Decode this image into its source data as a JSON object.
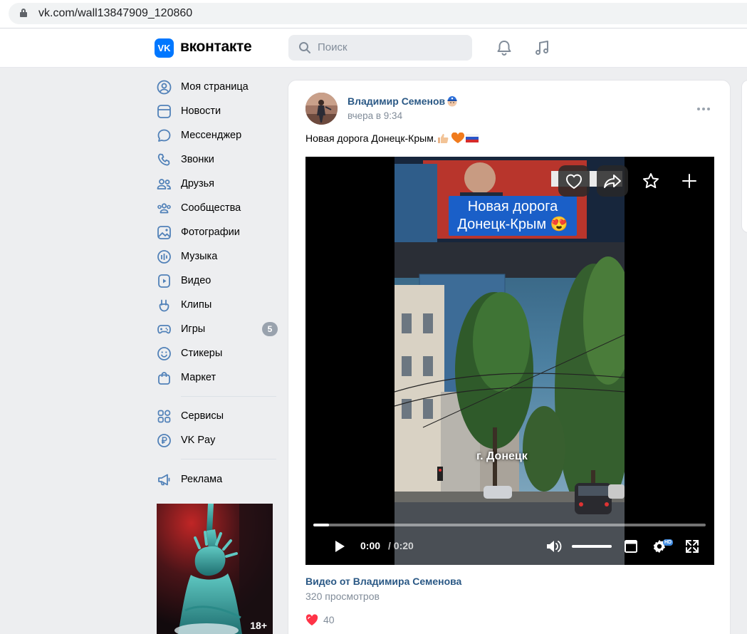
{
  "browser": {
    "url": "vk.com/wall13847909_120860"
  },
  "header": {
    "logo_mark": "VK",
    "logo_text": "вконтакте",
    "search_placeholder": "Поиск",
    "icons": [
      "bell-icon",
      "music-note-icon"
    ]
  },
  "sidebar": {
    "items": [
      {
        "label": "Моя страница",
        "icon": "user-circle-icon"
      },
      {
        "label": "Новости",
        "icon": "newsfeed-icon"
      },
      {
        "label": "Мессенджер",
        "icon": "message-bubble-icon"
      },
      {
        "label": "Звонки",
        "icon": "phone-icon"
      },
      {
        "label": "Друзья",
        "icon": "friends-icon"
      },
      {
        "label": "Сообщества",
        "icon": "communities-icon"
      },
      {
        "label": "Фотографии",
        "icon": "photo-icon"
      },
      {
        "label": "Музыка",
        "icon": "music-icon"
      },
      {
        "label": "Видео",
        "icon": "video-icon"
      },
      {
        "label": "Клипы",
        "icon": "clips-icon"
      },
      {
        "label": "Игры",
        "icon": "gamepad-icon",
        "badge": "5"
      },
      {
        "label": "Стикеры",
        "icon": "smile-icon"
      },
      {
        "label": "Маркет",
        "icon": "shopping-bag-icon"
      }
    ],
    "secondary": [
      {
        "label": "Сервисы",
        "icon": "services-grid-icon"
      },
      {
        "label": "VK Pay",
        "icon": "vk-pay-icon"
      }
    ],
    "tertiary": [
      {
        "label": "Реклама",
        "icon": "megaphone-icon"
      }
    ],
    "ad": {
      "age_badge": "18+"
    }
  },
  "post": {
    "author": "Владимир Семенов",
    "time": "вчера в 9:34",
    "text": "Новая дорога Донецк-Крым.",
    "text_emojis": [
      "thumbs-up",
      "orange-heart",
      "russia-flag"
    ],
    "video": {
      "caption_line1": "Новая дорога",
      "caption_line2": "Донецк-Крым 😍",
      "city_label": "г. Донецк",
      "current_time": "0:00",
      "total_time": "/ 0:20",
      "progress_fraction": 0.04,
      "volume_fraction": 1.0,
      "quality_badge": "HD",
      "title": "Видео от Владимира Семенова",
      "views": "320 просмотров"
    },
    "likes": "40"
  },
  "colors": {
    "accent": "#0077ff",
    "link": "#2a5885",
    "muted": "#818c99",
    "like": "#ff3347",
    "page_bg": "#edeef0"
  }
}
